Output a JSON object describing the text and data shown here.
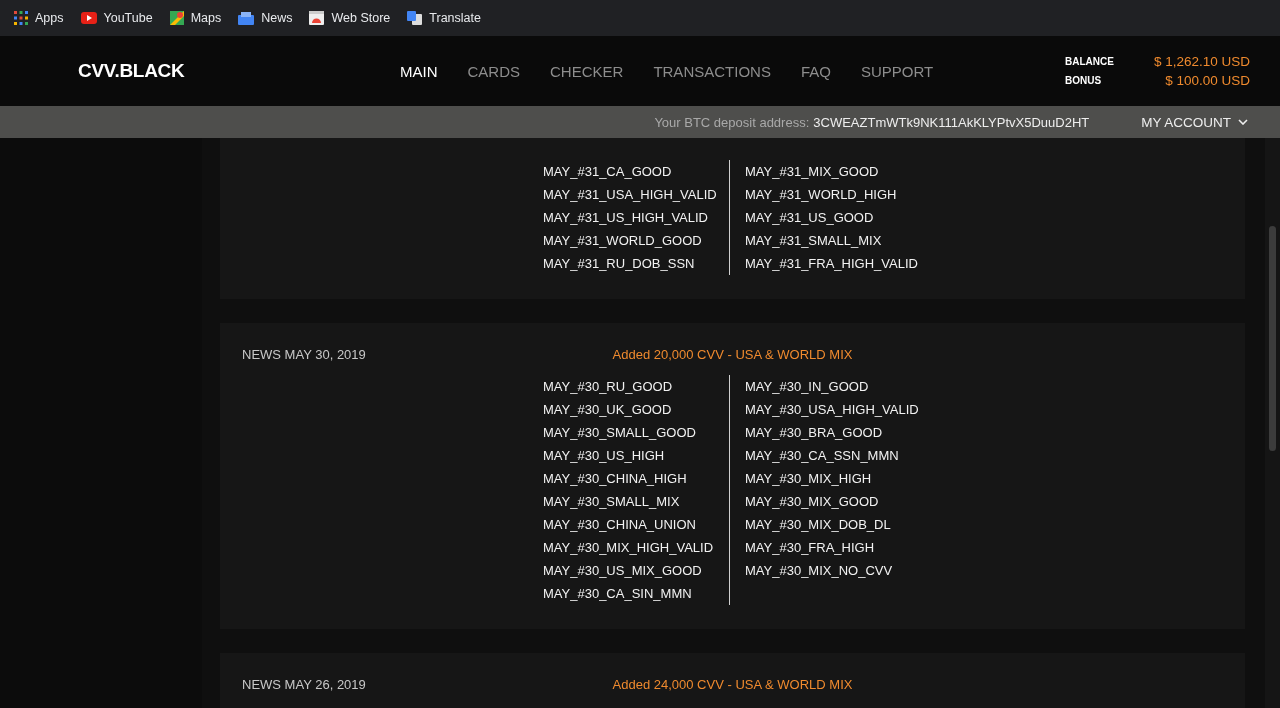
{
  "bookmarks": [
    {
      "label": "Apps"
    },
    {
      "label": "YouTube"
    },
    {
      "label": "Maps"
    },
    {
      "label": "News"
    },
    {
      "label": "Web Store"
    },
    {
      "label": "Translate"
    }
  ],
  "header": {
    "logo": "CVV.BLACK",
    "nav": [
      {
        "label": "MAIN",
        "selected": true
      },
      {
        "label": "CARDS",
        "selected": false
      },
      {
        "label": "CHECKER",
        "selected": false
      },
      {
        "label": "TRANSACTIONS",
        "selected": false
      },
      {
        "label": "FAQ",
        "selected": false
      },
      {
        "label": "SUPPORT",
        "selected": false
      }
    ],
    "balance": {
      "label": "BALANCE",
      "value": "$ 1,262.10 USD"
    },
    "bonus": {
      "label": "BONUS",
      "value": "$ 100.00 USD"
    }
  },
  "deposit_bar": {
    "label": "Your BTC deposit address:",
    "address": "3CWEAZTmWTk9NK111AkKLYPtvX5DuuD2HT",
    "account_menu": "MY ACCOUNT"
  },
  "news": [
    {
      "columns": [
        [
          "MAY_#31_CA_GOOD",
          "MAY_#31_USA_HIGH_VALID",
          "MAY_#31_US_HIGH_VALID",
          "MAY_#31_WORLD_GOOD",
          "MAY_#31_RU_DOB_SSN"
        ],
        [
          "MAY_#31_MIX_GOOD",
          "MAY_#31_WORLD_HIGH",
          "MAY_#31_US_GOOD",
          "MAY_#31_SMALL_MIX",
          "MAY_#31_FRA_HIGH_VALID"
        ]
      ]
    },
    {
      "date": "NEWS MAY 30, 2019",
      "headline": "Added 20,000 CVV - USA & WORLD MIX",
      "columns": [
        [
          "MAY_#30_RU_GOOD",
          "MAY_#30_UK_GOOD",
          "MAY_#30_SMALL_GOOD",
          "MAY_#30_US_HIGH",
          "MAY_#30_CHINA_HIGH",
          "MAY_#30_SMALL_MIX",
          "MAY_#30_CHINA_UNION",
          "MAY_#30_MIX_HIGH_VALID",
          "MAY_#30_US_MIX_GOOD",
          "MAY_#30_CA_SIN_MMN"
        ],
        [
          "MAY_#30_IN_GOOD",
          "MAY_#30_USA_HIGH_VALID",
          "MAY_#30_BRA_GOOD",
          "MAY_#30_CA_SSN_MMN",
          "MAY_#30_MIX_HIGH",
          "MAY_#30_MIX_GOOD",
          "MAY_#30_MIX_DOB_DL",
          "MAY_#30_FRA_HIGH",
          "MAY_#30_MIX_NO_CVV"
        ]
      ]
    },
    {
      "date": "NEWS MAY 26, 2019",
      "headline": "Added 24,000 CVV - USA & WORLD MIX"
    }
  ]
}
